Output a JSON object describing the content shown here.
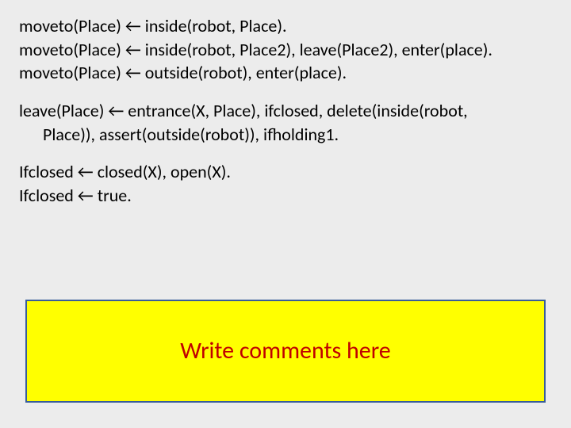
{
  "blocks": {
    "b1l1": "moveto(Place) ← inside(robot, Place).",
    "b1l2": "moveto(Place) ← inside(robot, Place2), leave(Place2), enter(place).",
    "b1l3": "moveto(Place) ← outside(robot), enter(place).",
    "b2l1": "leave(Place) ← entrance(X, Place), ifclosed, delete(inside(robot,",
    "b2l2": "Place)), assert(outside(robot)), ifholding1.",
    "b3l1": "Ifclosed ← closed(X), open(X).",
    "b3l2": "Ifclosed ← true."
  },
  "comment": {
    "text": "Write comments here"
  }
}
